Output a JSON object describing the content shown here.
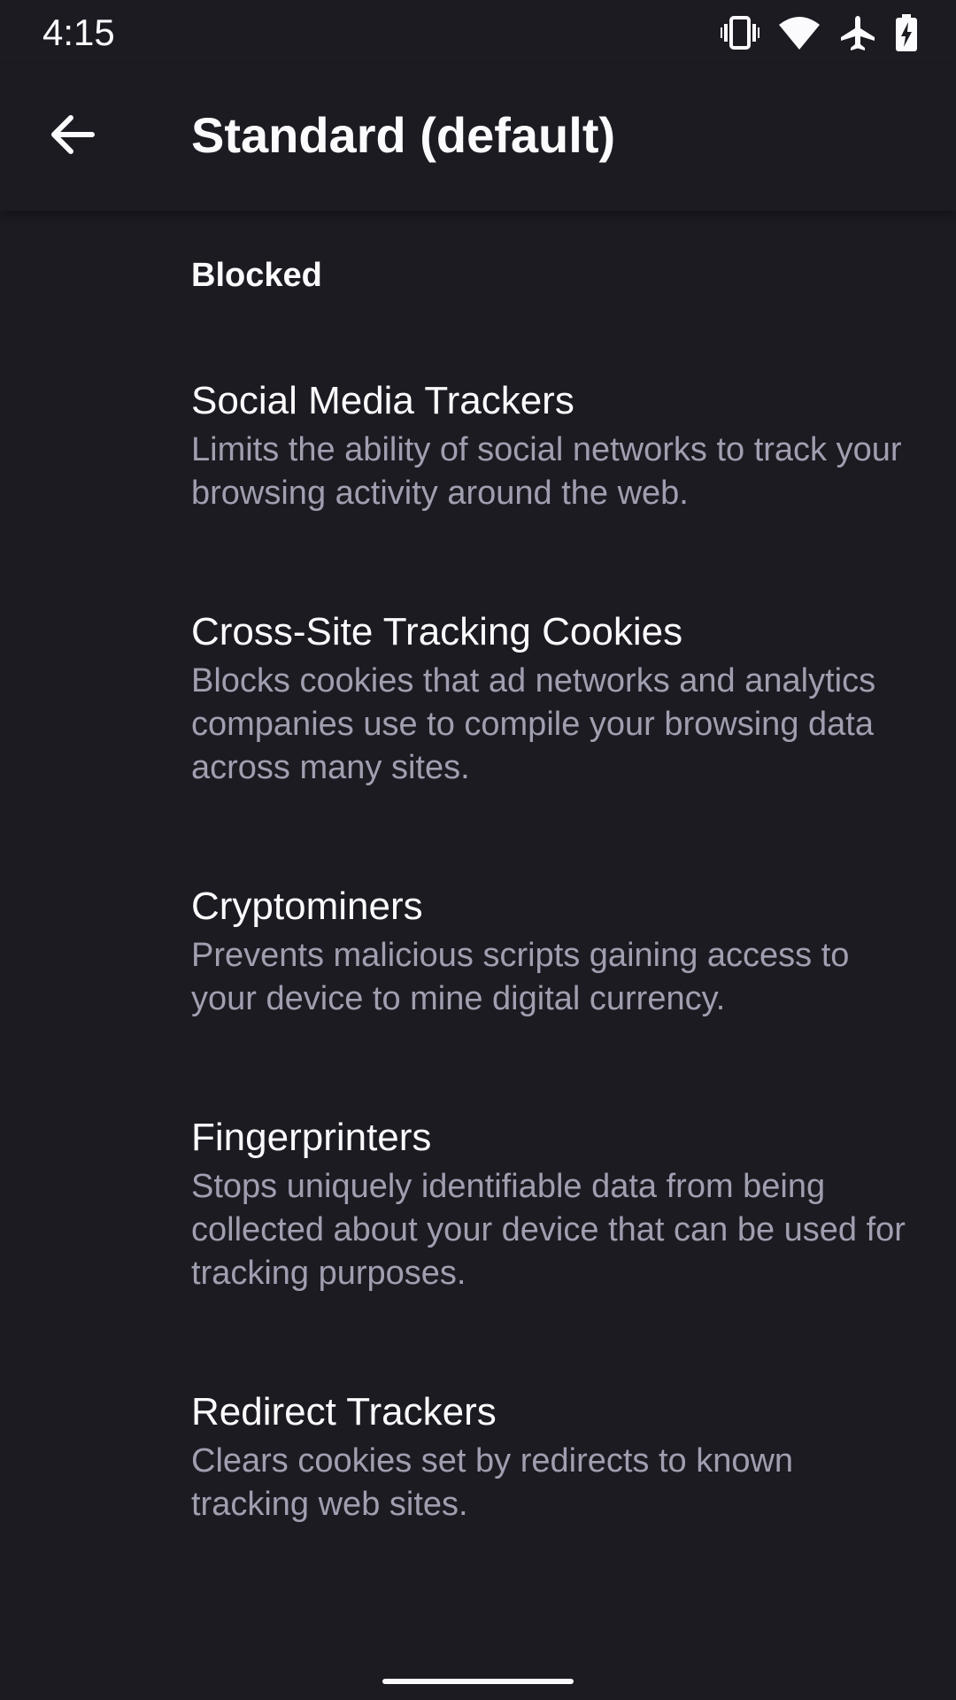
{
  "status_bar": {
    "time": "4:15",
    "icons": [
      "vibrate-icon",
      "wifi-icon",
      "airplane-mode-icon",
      "battery-charging-icon"
    ]
  },
  "app_bar": {
    "title": "Standard (default)",
    "back_icon": "back-arrow-icon"
  },
  "section": {
    "header": "Blocked"
  },
  "trackers": [
    {
      "title": "Social Media Trackers",
      "description": "Limits the ability of social networks to track your browsing activity around the web."
    },
    {
      "title": "Cross-Site Tracking Cookies",
      "description": "Blocks cookies that ad networks and analytics companies use to compile your browsing data across many sites."
    },
    {
      "title": "Cryptominers",
      "description": "Prevents malicious scripts gaining access to your device to mine digital currency."
    },
    {
      "title": "Fingerprinters",
      "description": "Stops uniquely identifiable data from being collected about your device that can be used for tracking purposes."
    },
    {
      "title": "Redirect Trackers",
      "description": "Clears cookies set by redirects to known tracking web sites."
    }
  ],
  "colors": {
    "background": "#1c1b22",
    "primary_text": "#fbfbfe",
    "secondary_text": "#a09fb0"
  }
}
